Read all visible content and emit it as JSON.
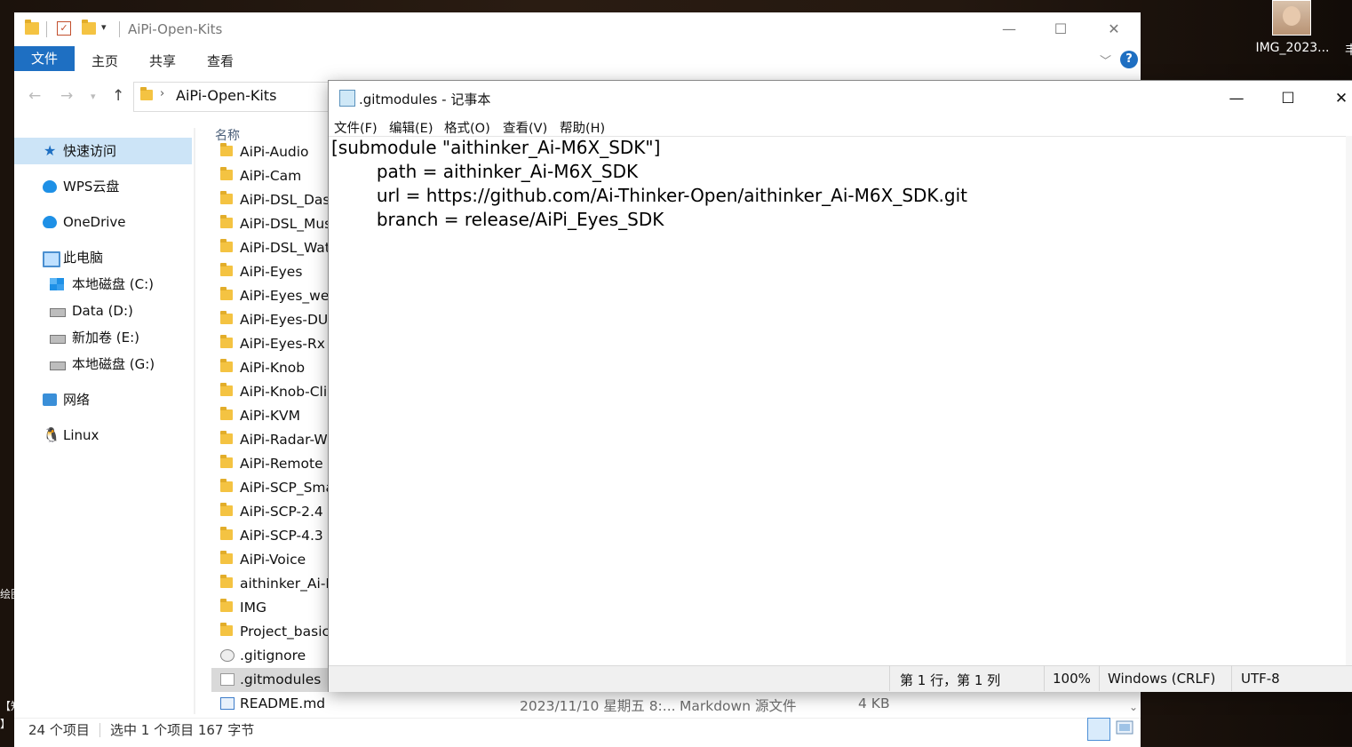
{
  "desktop": {
    "icon_label": "IMG_2023...",
    "edge_glyph": "丰",
    "left_glyphs": [
      "绘图",
      "【知",
      "】"
    ]
  },
  "explorer": {
    "title": "AiPi-Open-Kits",
    "ribbon": {
      "file_tab": "文件",
      "home": "主页",
      "share": "共享",
      "view": "查看"
    },
    "address": {
      "path": "AiPi-Open-Kits"
    },
    "column_name": "名称",
    "sidebar": {
      "quick_access": "快速访问",
      "wps": "WPS云盘",
      "onedrive": "OneDrive",
      "this_pc": "此电脑",
      "drives": [
        "本地磁盘 (C:)",
        "Data (D:)",
        "新加卷 (E:)",
        "本地磁盘 (G:)"
      ],
      "network": "网络",
      "linux": "Linux"
    },
    "files": [
      "AiPi-Audio",
      "AiPi-Cam",
      "AiPi-DSL_Dash",
      "AiPi-DSL_Mus",
      "AiPi-DSL_Wat",
      "AiPi-Eyes",
      "AiPi-Eyes_wea",
      "AiPi-Eyes-DU",
      "AiPi-Eyes-Rx",
      "AiPi-Knob",
      "AiPi-Knob-Cli",
      "AiPi-KVM",
      "AiPi-Radar-W",
      "AiPi-Remote",
      "AiPi-SCP_Sma",
      "AiPi-SCP-2.4",
      "AiPi-SCP-4.3",
      "AiPi-Voice",
      "aithinker_Ai-N",
      "IMG",
      "Project_basic",
      ".gitignore",
      ".gitmodules",
      "README.md"
    ],
    "readme": {
      "date": "2023/11/10 星期五 8:...",
      "type": "Markdown 源文件",
      "size": "4 KB"
    },
    "status": {
      "count": "24 个项目",
      "selected": "选中 1 个项目  167 字节"
    }
  },
  "notepad": {
    "title": ".gitmodules - 记事本",
    "menu": [
      "文件(F)",
      "编辑(E)",
      "格式(O)",
      "查看(V)",
      "帮助(H)"
    ],
    "content": "[submodule \"aithinker_Ai-M6X_SDK\"]\n\tpath = aithinker_Ai-M6X_SDK\n\turl = https://github.com/Ai-Thinker-Open/aithinker_Ai-M6X_SDK.git\n\tbranch = release/AiPi_Eyes_SDK",
    "status": {
      "position": "第 1 行，第 1 列",
      "zoom": "100%",
      "line_ending": "Windows (CRLF)",
      "encoding": "UTF-8"
    }
  },
  "colors": {
    "accent": "#1e6fc2",
    "selection": "#cce4f7",
    "row_selected": "#d9d9d9"
  },
  "icons": {
    "quick_access": "star-icon",
    "wps": "cloud-icon",
    "onedrive": "cloud-icon",
    "this_pc": "computer-icon",
    "drive": "drive-icon",
    "network": "network-icon",
    "linux": "penguin-icon",
    "folder": "folder-icon",
    "notepad": "notepad-icon"
  }
}
